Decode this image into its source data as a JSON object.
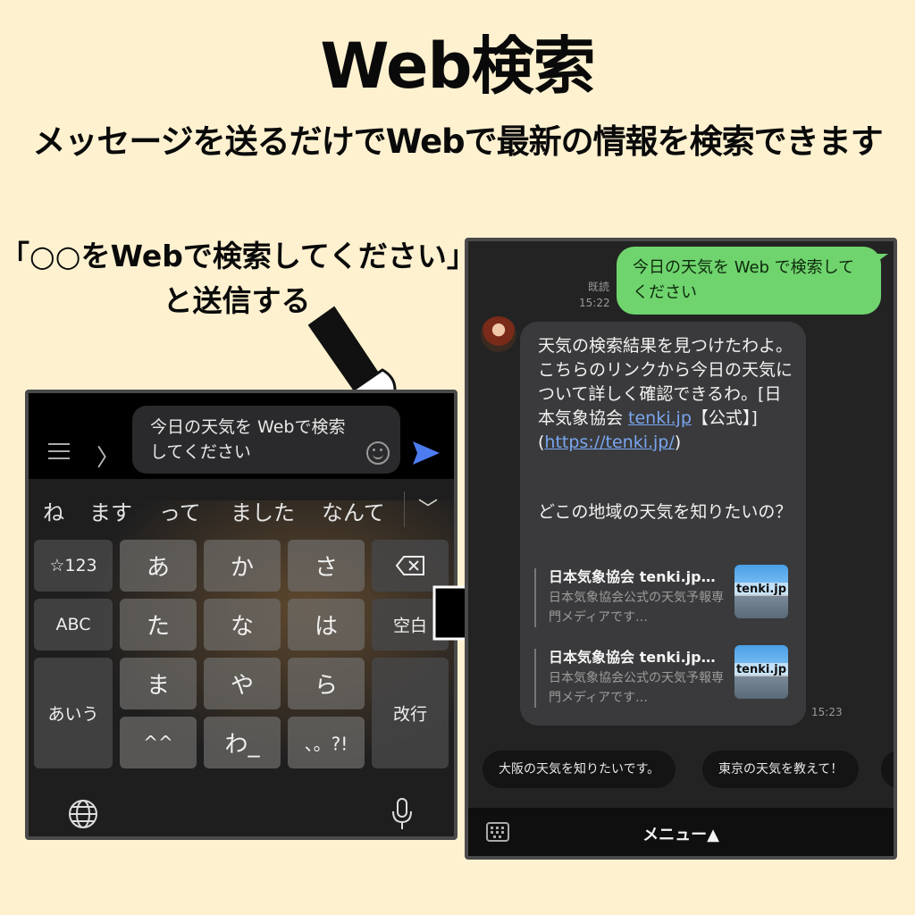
{
  "title": "Web検索",
  "subtitle": "メッセージを送るだけでWebで最新の情報を検索できます",
  "callout": {
    "line1": "「○○をWebで検索してください」",
    "line2": "と送信する"
  },
  "keyboard_screen": {
    "input_text": "今日の天気を Webで検索してください",
    "suggestions": [
      "ね",
      "ます",
      "って",
      "ました",
      "なんて"
    ],
    "keys": {
      "symbols": "☆123",
      "a": "あ",
      "ka": "か",
      "sa": "さ",
      "abc": "ABC",
      "ta": "た",
      "na": "な",
      "ha": "は",
      "space": "空白",
      "aiu": "あいう",
      "ma": "ま",
      "ya": "や",
      "ra": "ら",
      "enter": "改行",
      "dakuten": "^^",
      "wa": "わ_",
      "punct": "、。?!"
    },
    "colors": {
      "send": "#4d7cf0"
    }
  },
  "chat_screen": {
    "sent_message": "今日の天気を Web で検索してください",
    "read_label": "既読",
    "sent_time": "15:22",
    "reply_text_a": "天気の検索結果を見つけたわよ。こちらのリンクから今日の天気について詳しく確認できるわ。[日本気象協会 ",
    "reply_link_1": "tenki.jp",
    "reply_text_b": "【公式】](",
    "reply_link_2": "https://tenki.jp/",
    "reply_text_c": ")",
    "reply_question": "どこの地域の天気を知りたいの？",
    "reply_time": "15:23",
    "cards": [
      {
        "title": "日本気象協会 tenki.jp【公式】",
        "desc": "日本気象協会公式の天気予報専門メディアです…",
        "thumb": "tenki.jp"
      },
      {
        "title": "日本気象協会 tenki.jp【公式】",
        "desc": "日本気象協会公式の天気予報専門メディアです…",
        "thumb": "tenki.jp"
      }
    ],
    "quick_replies": [
      "大阪の天気を知りたいです。",
      "東京の天気を教えて！"
    ],
    "menu_label": "メニュー▲",
    "colors": {
      "sent_bubble": "#6fd46d",
      "link": "#79a6f0"
    }
  }
}
